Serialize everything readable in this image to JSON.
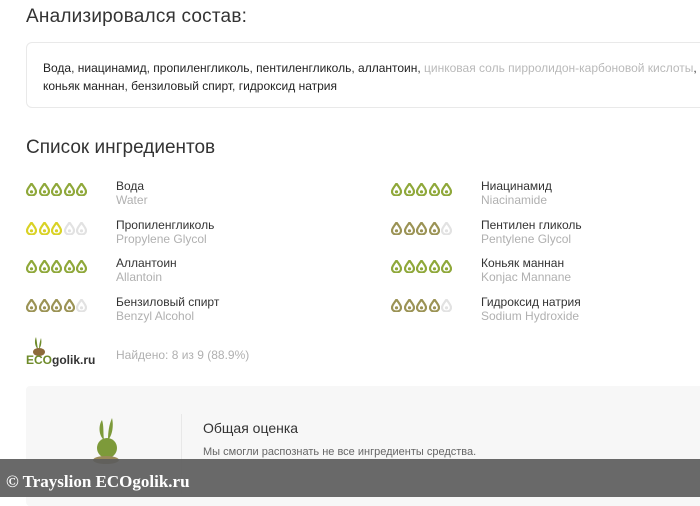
{
  "composition": {
    "title": "Анализировался состав:",
    "items": [
      {
        "name": "Вода",
        "sep": ", ",
        "recognized": true
      },
      {
        "name": "ниацинамид",
        "sep": ", ",
        "recognized": true
      },
      {
        "name": "пропиленгликоль",
        "sep": ", ",
        "recognized": true
      },
      {
        "name": "пентиленгликоль",
        "sep": ", ",
        "recognized": true
      },
      {
        "name": "аллантоин",
        "sep": ", ",
        "recognized": true
      },
      {
        "name": "цинковая соль пирролидон-карбоновой кислоты",
        "sep": ", ",
        "recognized": false
      },
      {
        "name": "коньяк маннан",
        "sep": ", ",
        "recognized": true
      },
      {
        "name": "бензиловый спирт",
        "sep": ", ",
        "recognized": true
      },
      {
        "name": "гидроксид натрия",
        "sep": "",
        "recognized": true
      }
    ]
  },
  "ingredients_list": {
    "title": "Список ингредиентов",
    "items": [
      {
        "ru": "Вода",
        "en": "Water",
        "rating": 5,
        "rating_color": "#8fa83a"
      },
      {
        "ru": "Ниацинамид",
        "en": "Niacinamide",
        "rating": 5,
        "rating_color": "#8fa83a"
      },
      {
        "ru": "Пропиленгликоль",
        "en": "Propylene Glycol",
        "rating": 3,
        "rating_color": "#d9d226"
      },
      {
        "ru": "Пентилен гликоль",
        "en": "Pentylene Glycol",
        "rating": 4,
        "rating_color": "#9b9355"
      },
      {
        "ru": "Аллантоин",
        "en": "Allantoin",
        "rating": 5,
        "rating_color": "#8fa83a"
      },
      {
        "ru": "Коньяк маннан",
        "en": "Konjac Mannane",
        "rating": 5,
        "rating_color": "#8fa83a"
      },
      {
        "ru": "Бензиловый спирт",
        "en": "Benzyl Alcohol",
        "rating": 4,
        "rating_color": "#9b9355"
      },
      {
        "ru": "Гидроксид натрия",
        "en": "Sodium Hydroxide",
        "rating": 4,
        "rating_color": "#9b9355"
      }
    ],
    "empty_drop_color": "#e2e2e2"
  },
  "logo": {
    "text_eco": "ECO",
    "text_rest": "golik.ru"
  },
  "found_text": "Найдено: 8 из 9 (88.9%)",
  "summary": {
    "title": "Общая оценка",
    "note": "Мы смогли распознать не все ингредиенты средства."
  },
  "watermark": "© Trayslion ECOgolik.ru"
}
